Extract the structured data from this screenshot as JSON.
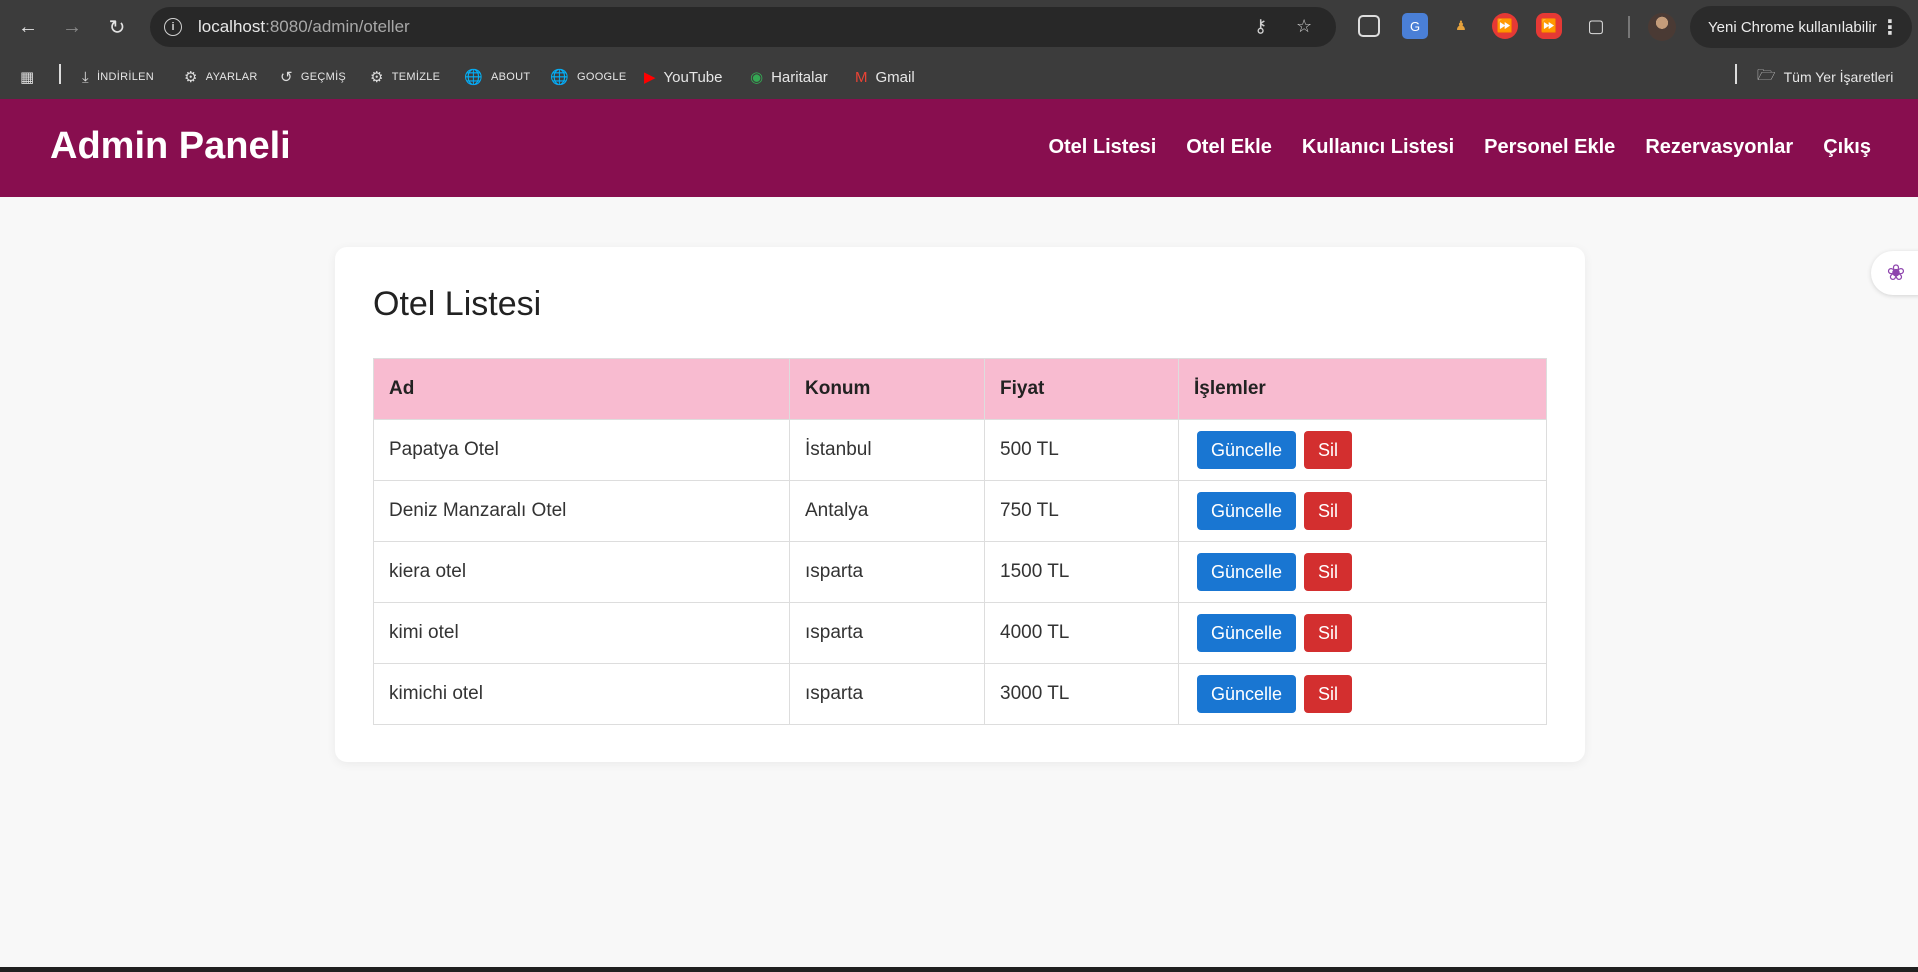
{
  "browser": {
    "url_host": "localhost",
    "url_path": ":8080/admin/oteller",
    "update_label": "Yeni Chrome kullanılabilir",
    "bookmarks": [
      {
        "label": "İNDİRİLEN",
        "icon": "download-icon"
      },
      {
        "label": "AYARLAR",
        "icon": "gear-icon"
      },
      {
        "label": "GEÇMİŞ",
        "icon": "history-icon"
      },
      {
        "label": "TEMİZLE",
        "icon": "gear-icon"
      },
      {
        "label": "ABOUT",
        "icon": "globe-icon"
      },
      {
        "label": "GOOGLE",
        "icon": "globe-icon"
      },
      {
        "label": "YouTube",
        "icon": "youtube-icon"
      },
      {
        "label": "Haritalar",
        "icon": "maps-icon"
      },
      {
        "label": "Gmail",
        "icon": "gmail-icon"
      }
    ],
    "all_bookmarks": "Tüm Yer İşaretleri"
  },
  "header": {
    "brand": "Admin Paneli",
    "nav": [
      "Otel Listesi",
      "Otel Ekle",
      "Kullanıcı Listesi",
      "Personel Ekle",
      "Rezervasyonlar",
      "Çıkış"
    ]
  },
  "main": {
    "title": "Otel Listesi",
    "columns": [
      "Ad",
      "Konum",
      "Fiyat",
      "İşlemler"
    ],
    "rows": [
      {
        "name": "Papatya Otel",
        "location": "İstanbul",
        "price": "500 TL"
      },
      {
        "name": "Deniz Manzaralı Otel",
        "location": "Antalya",
        "price": "750 TL"
      },
      {
        "name": "kiera otel",
        "location": "ısparta",
        "price": "1500 TL"
      },
      {
        "name": "kimi otel",
        "location": "ısparta",
        "price": "4000 TL"
      },
      {
        "name": "kimichi otel",
        "location": "ısparta",
        "price": "3000 TL"
      }
    ],
    "edit_label": "Güncelle",
    "delete_label": "Sil"
  },
  "colors": {
    "header_bg": "#880e4f",
    "table_header_bg": "#f8bbd0",
    "edit_button": "#1976d2",
    "delete_button": "#d32f2f"
  }
}
